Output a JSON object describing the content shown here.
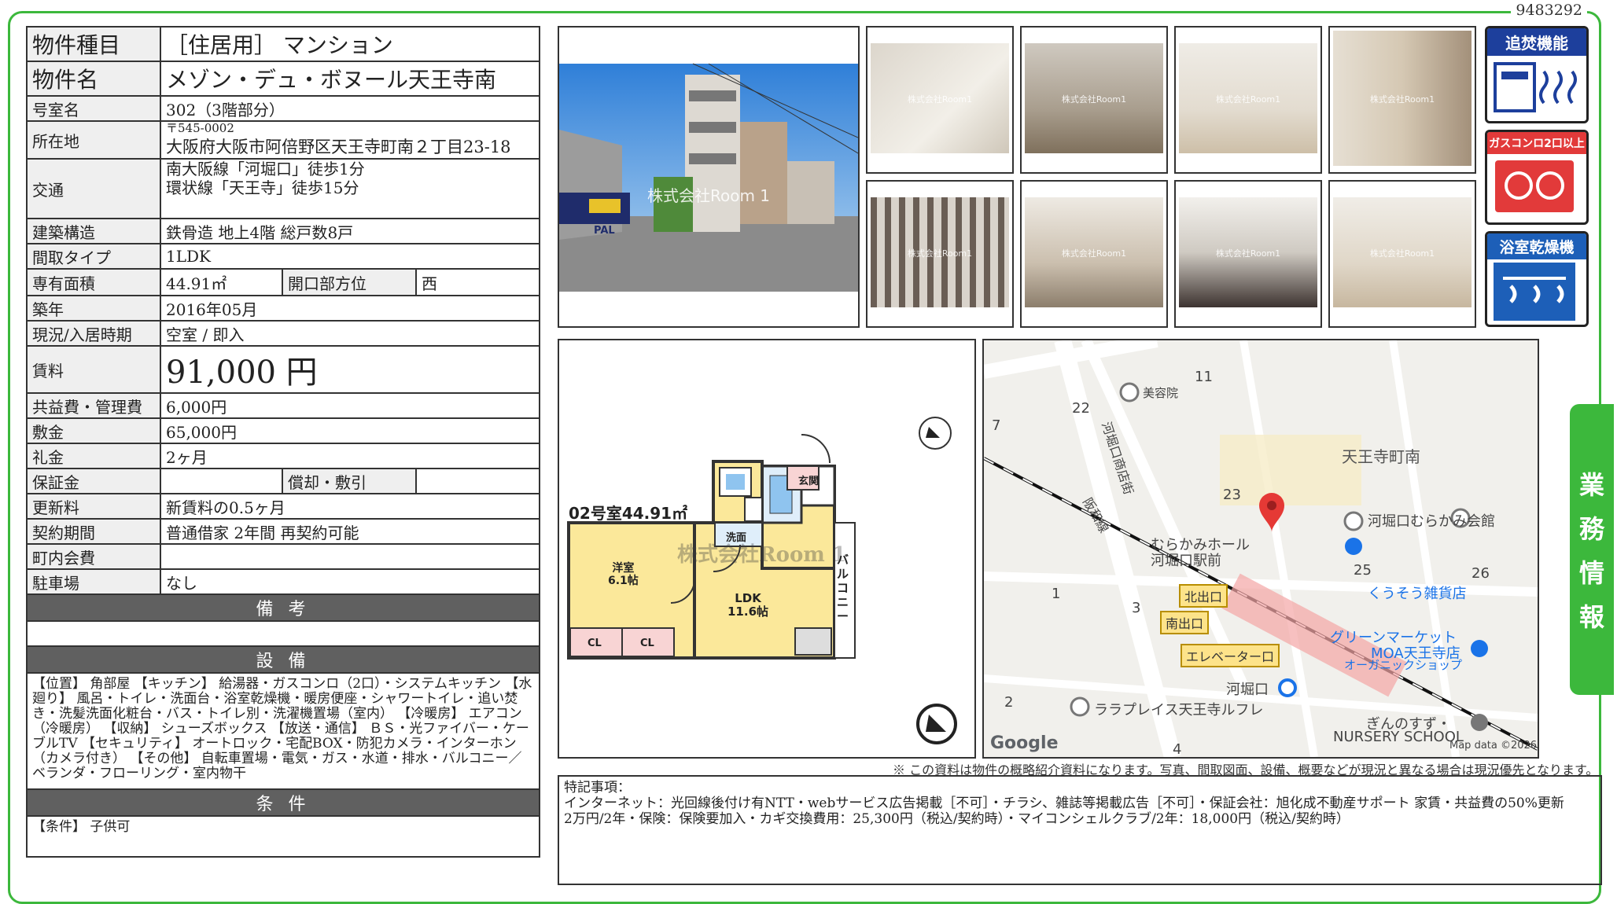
{
  "doc_id": "9483292",
  "side_tab": [
    "業",
    "務",
    "情",
    "報"
  ],
  "property": {
    "type_label": "物件種目",
    "type_value": "［住居用］ マンション",
    "name_label": "物件名",
    "name_value": "メゾン・デュ・ボヌール天王寺南",
    "room_label": "号室名",
    "room_value": "302（3階部分）",
    "address_label": "所在地",
    "postal": "〒545-0002",
    "address_value": "大阪府大阪市阿倍野区天王寺町南２丁目23-18",
    "access_label": "交通",
    "access_1": "南大阪線「河堀口」徒歩1分",
    "access_2": "環状線「天王寺」徒歩15分",
    "structure_label": "建築構造",
    "structure_value": "鉄骨造 地上4階 総戸数8戸",
    "layout_label": "間取タイプ",
    "layout_value": "1LDK",
    "area_label": "専有面積",
    "area_value": "44.91㎡",
    "direction_label": "開口部方位",
    "direction_value": "西",
    "built_label": "築年",
    "built_value": "2016年05月",
    "status_label": "現況/入居時期",
    "status_value": "空室 / 即入",
    "rent_label": "賃料",
    "rent_value": "91,000 円",
    "fee_label": "共益費・管理費",
    "fee_value": "6,000円",
    "deposit_label": "敷金",
    "deposit_value": "65,000円",
    "key_label": "礼金",
    "key_value": "2ヶ月",
    "guarantee_label": "保証金",
    "guarantee_value": "",
    "amort_label": "償却・敷引",
    "amort_value": "",
    "renew_label": "更新料",
    "renew_value": "新賃料の0.5ヶ月",
    "contract_label": "契約期間",
    "contract_value": "普通借家 2年間 再契約可能",
    "assoc_label": "町内会費",
    "assoc_value": "",
    "parking_label": "駐車場",
    "parking_value": "なし"
  },
  "sections": {
    "remarks_title": "備 考",
    "remarks_text": "",
    "equipment_title": "設 備",
    "equipment_text": "【位置】 角部屋 【キッチン】 給湯器・ガスコンロ（2口）・システムキッチン 【水廻り】 風呂・トイレ・洗面台・浴室乾燥機・暖房便座・シャワートイレ・追い焚き・洗髪洗面化粧台・バス・トイレ別・洗濯機置場（室内） 【冷暖房】 エアコン（冷暖房） 【収納】 シューズボックス 【放送・通信】 ＢＳ・光ファイバー・ケーブルTV 【セキュリティ】 オートロック・宅配BOX・防犯カメラ・インターホン（カメラ付き） 【その他】 自転車置場・電気・ガス・水道・排水・バルコニー／ベランダ・フローリング・室内物干",
    "conditions_title": "条 件",
    "conditions_text": "【条件】 子供可"
  },
  "photos": {
    "watermark": "株式会社Room1",
    "exterior_watermark": "株式会社Room 1",
    "store_sign": "PAL"
  },
  "badges": [
    {
      "label": "追焚機能",
      "color": "#1d3f9c"
    },
    {
      "label": "ガスコンロ2口以上",
      "color": "#e23a3a"
    },
    {
      "label": "浴室乾燥機",
      "color": "#1d5fb8"
    }
  ],
  "floorplan": {
    "title": "02号室44.91㎡",
    "watermark": "株式会社Room 1",
    "western_room": "洋室",
    "western_size": "6.1帖",
    "ldk": "LDK",
    "ldk_size": "11.6帖",
    "cl1": "CL",
    "cl2": "CL",
    "washroom": "洗面",
    "entrance": "玄関",
    "balcony": "バルコニー"
  },
  "map": {
    "labels": {
      "beauty": "美容院",
      "n11": "11",
      "n22": "22",
      "n7": "7",
      "kabori_street": "河堀口商店街",
      "hanwa": "阪和線",
      "district": "天王寺町南",
      "n23": "23",
      "hall_1": "むらかみホール",
      "hall_2": "河堀口駅前",
      "murakami_kaikan": "河堀口むらかみ会館",
      "n25": "25",
      "n26": "26",
      "kusouzou": "くうそう雑貨店",
      "n1": "1",
      "n3": "3",
      "green_1": "グリーンマーケット",
      "green_2": "MOA天王寺店",
      "green_3": "オーガニックショップ",
      "station": "河堀口",
      "n2": "2",
      "lalaplace": "ララプレイス天王寺ルフレ",
      "nursery_1": "ぎんのすず・",
      "nursery_2": "NURSERY SCHOOL",
      "n4": "4",
      "google": "Google",
      "mapdata": "Map data ©2026"
    },
    "exits": {
      "north": "北出口",
      "south": "南出口",
      "elevator": "エレベーター口"
    }
  },
  "disclaimer": "※ この資料は物件の概略紹介資料になります。写真、間取図面、設備、概要などが現況と異なる場合は現況優先となります。",
  "special": {
    "title": "特記事項：",
    "line1": "インターネット：光回線後付け有NTT・webサービス広告掲載［不可］・チラシ、雑誌等掲載広告［不可］・保証会社：旭化成不動産サポート 家賃・共益費の50%更新",
    "line2": "2万円/2年・保険：保険要加入・カギ交換費用：25,300円（税込/契約時）・マイコンシェルクラブ/2年：18,000円（税込/契約時）"
  }
}
